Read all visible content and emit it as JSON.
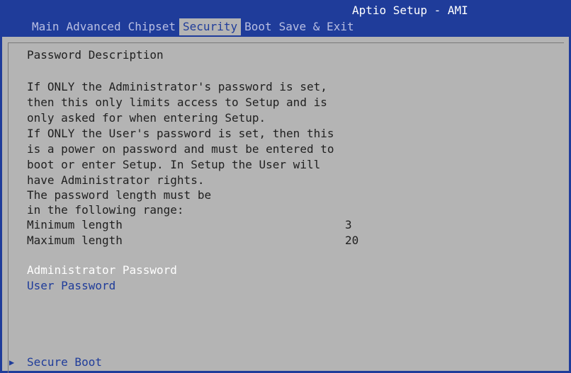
{
  "header": {
    "title": "Aptio Setup - AMI",
    "tabs": [
      {
        "label": "Main"
      },
      {
        "label": "Advanced"
      },
      {
        "label": "Chipset"
      },
      {
        "label": "Security"
      },
      {
        "label": "Boot"
      },
      {
        "label": "Save & Exit"
      }
    ],
    "active_tab": "Security"
  },
  "content": {
    "section_title": "Password Description",
    "description_lines": [
      "If ONLY the Administrator's password is set,",
      "then this only limits access to Setup and is",
      "only asked for when entering Setup.",
      "If ONLY the User's password is set, then this",
      "is a power on password and must be entered to",
      "boot or enter Setup. In Setup the User will",
      "have Administrator rights.",
      "The password length must be",
      "in the following range:"
    ],
    "min_length_label": "Minimum length",
    "min_length_value": "3",
    "max_length_label": "Maximum length",
    "max_length_value": "20",
    "admin_password_label": "Administrator Password",
    "user_password_label": "User Password",
    "secure_boot_label": "Secure Boot"
  },
  "colors": {
    "background_blue": "#1f3c9a",
    "panel_gray": "#b4b4b4",
    "text_dark": "#1f1f1f",
    "highlight_white": "#ffffff"
  }
}
